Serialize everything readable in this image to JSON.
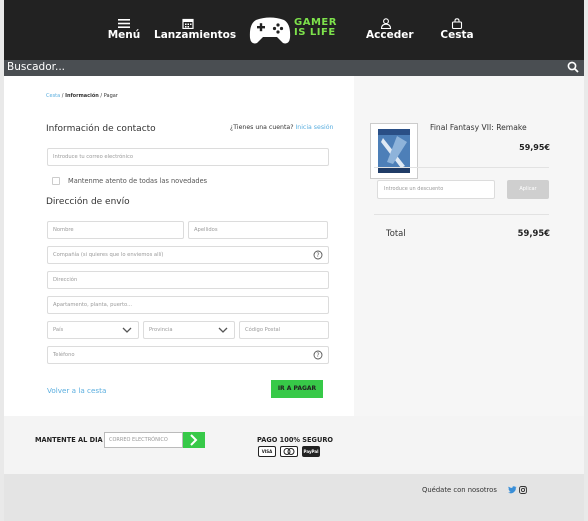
{
  "header": {
    "nav": [
      {
        "label": "Menú",
        "icon": "hamburger-icon"
      },
      {
        "label": "Lanzamientos",
        "icon": "calendar-icon"
      },
      {
        "label": "Acceder",
        "icon": "user-icon"
      },
      {
        "label": "Cesta",
        "icon": "bag-icon"
      }
    ],
    "logo_text_1": "GAMER",
    "logo_text_2": "IS LIFE"
  },
  "search": {
    "placeholder": "Buscador...",
    "icon": "search-icon"
  },
  "breadcrumb": {
    "cart": "Cesta",
    "sep": " / ",
    "info": "Información",
    "sep2": " / ",
    "pay": "Pagar"
  },
  "contact": {
    "title": "Información de contacto",
    "have_account": "¿Tienes una cuenta?",
    "login_link": "Inicia sesión",
    "email_placeholder": "Introduce tu correo electrónico",
    "newsletter_label": "Mantenme atento de todas las novedades"
  },
  "shipping": {
    "title": "Dirección de envío",
    "first_name": "Nombre",
    "last_name": "Apellidos",
    "company": "Compañía (si quieres que lo enviemos allí)",
    "address": "Dirección",
    "apartment": "Apartamento, planta, puerto...",
    "country": "País",
    "province": "Provincia",
    "postal": "Código Postal",
    "phone": "Teléfono"
  },
  "actions": {
    "back": "Volver a la cesta",
    "pay": "IR A PAGAR"
  },
  "summary": {
    "product_name": "Final Fantasy VII: Remake",
    "product_price": "59,95€",
    "discount_placeholder": "Introduce un descuento",
    "apply": "Aplicar",
    "total_label": "Total",
    "total_value": "59,95€"
  },
  "footer": {
    "keep_label": "MANTENTE AL DIA",
    "email_placeholder": "CORREO ELECTRÓNICO",
    "secure_label": "PAGO 100% SEGURO",
    "cards": [
      "VISA",
      "mastercard",
      "PayPal"
    ],
    "follow": "Quédate con nosotros"
  },
  "colors": {
    "header_bg": "#222222",
    "accent_green": "#37c948",
    "link_blue": "#5aaedf"
  }
}
